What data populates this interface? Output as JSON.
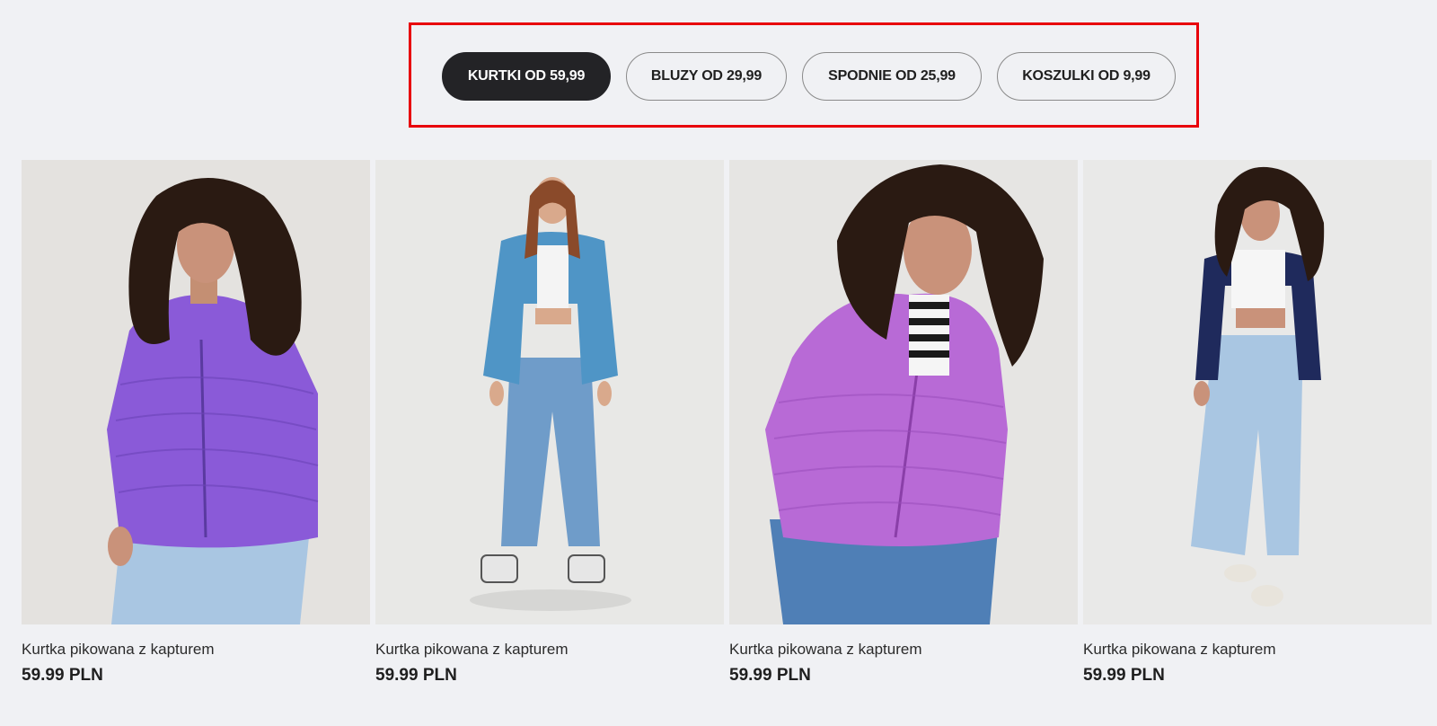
{
  "filters": {
    "pills": [
      {
        "label": "KURTKI OD 59,99",
        "active": true
      },
      {
        "label": "BLUZY OD 29,99",
        "active": false
      },
      {
        "label": "SPODNIE OD 25,99",
        "active": false
      },
      {
        "label": "KOSZULKI OD 9,99",
        "active": false
      }
    ]
  },
  "products": [
    {
      "title": "Kurtka pikowana z kapturem",
      "price": "59.99 PLN",
      "jacket_color": "#8a5ad8",
      "photo": "model-purple-jacket"
    },
    {
      "title": "Kurtka pikowana z kapturem",
      "price": "59.99 PLN",
      "jacket_color": "#4f95c6",
      "photo": "model-blue-jacket"
    },
    {
      "title": "Kurtka pikowana z kapturem",
      "price": "59.99 PLN",
      "jacket_color": "#b86ad6",
      "photo": "model-lilac-jacket"
    },
    {
      "title": "Kurtka pikowana z kapturem",
      "price": "59.99 PLN",
      "jacket_color": "#1f2a5c",
      "photo": "model-navy-jacket"
    }
  ],
  "colors": {
    "highlight": "#e8000b",
    "active_pill": "#232326",
    "background": "#f0f1f4"
  }
}
